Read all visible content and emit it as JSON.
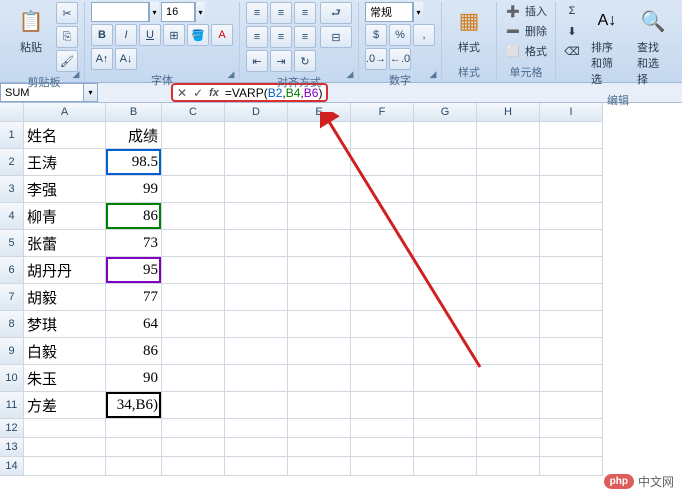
{
  "ribbon": {
    "clipboard": {
      "paste": "粘贴",
      "group": "剪贴板"
    },
    "font": {
      "name": "",
      "size": "16",
      "group": "字体",
      "bold": "B",
      "italic": "I",
      "underline": "U"
    },
    "align": {
      "group": "对齐方式"
    },
    "number": {
      "format": "常规",
      "group": "数字"
    },
    "styles": {
      "label": "样式",
      "group": "样式"
    },
    "cells": {
      "insert": "插入",
      "delete": "删除",
      "format": "格式",
      "group": "单元格"
    },
    "editing": {
      "sigma": "Σ",
      "sortfilter": "排序和筛选",
      "findselect": "查找和选择",
      "group": "编辑"
    }
  },
  "namebox": "SUM",
  "formula": {
    "prefix": "=VARP(",
    "r1": "B2",
    "c1": ",",
    "r2": "B4",
    "c2": ",",
    "r3": "B6",
    "suffix": ")"
  },
  "cols": [
    "A",
    "B",
    "C",
    "D",
    "E",
    "F",
    "G",
    "H",
    "I"
  ],
  "rowcount": 14,
  "data": {
    "A1": "姓名",
    "B1": "成绩",
    "A2": "王涛",
    "B2": "98.5",
    "A3": "李强",
    "B3": "99",
    "A4": "柳青",
    "B4": "86",
    "A5": "张蕾",
    "B5": "73",
    "A6": "胡丹丹",
    "B6": "95",
    "A7": "胡毅",
    "B7": "77",
    "A8": "梦琪",
    "B8": "64",
    "A9": "白毅",
    "B9": "86",
    "A10": "朱玉",
    "B10": "90",
    "A11": "方差",
    "B11": "34,B6)"
  },
  "watermark": {
    "logo": "php",
    "text": "中文网"
  }
}
